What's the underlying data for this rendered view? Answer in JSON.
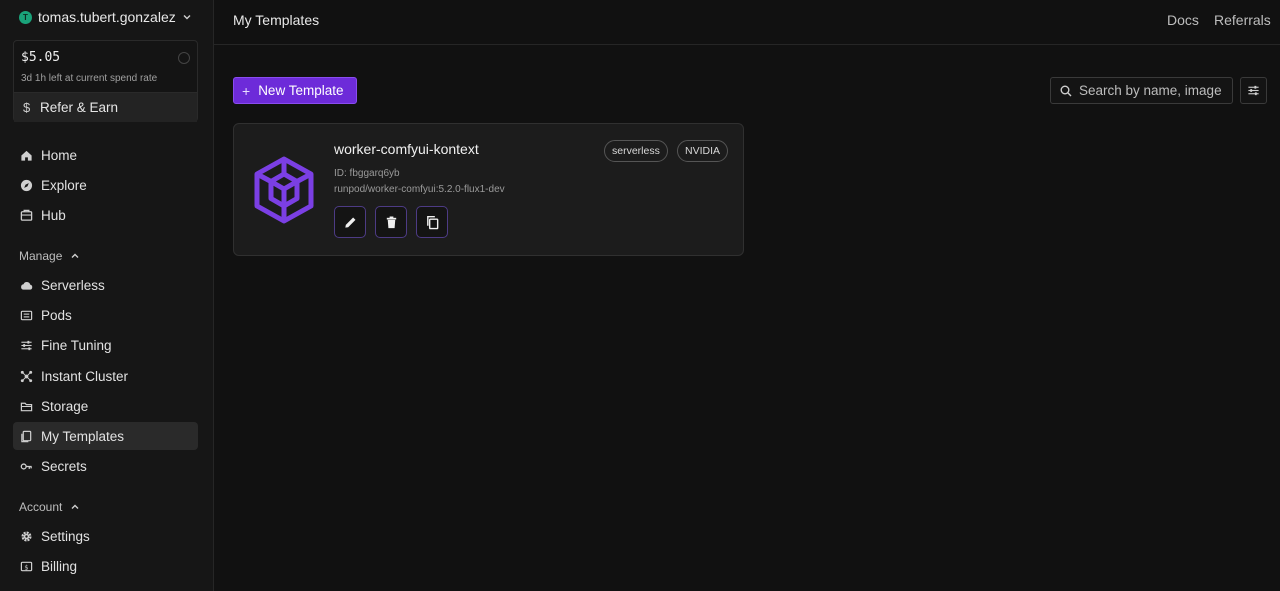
{
  "sidebar": {
    "account": {
      "initial": "T",
      "username": "tomas.tubert.gonzalez"
    },
    "balance": {
      "amount": "$5.05",
      "subtext": "3d 1h left at current spend rate",
      "refer_label": "Refer & Earn"
    },
    "nav_main": [
      {
        "label": "Home",
        "icon": "home-icon"
      },
      {
        "label": "Explore",
        "icon": "compass-icon"
      },
      {
        "label": "Hub",
        "icon": "hub-icon"
      }
    ],
    "manage": {
      "label": "Manage",
      "items": [
        {
          "label": "Serverless",
          "icon": "cloud-icon"
        },
        {
          "label": "Pods",
          "icon": "pods-icon"
        },
        {
          "label": "Fine Tuning",
          "icon": "sliders-icon"
        },
        {
          "label": "Instant Cluster",
          "icon": "cluster-icon"
        },
        {
          "label": "Storage",
          "icon": "storage-icon"
        },
        {
          "label": "My Templates",
          "icon": "templates-icon",
          "active": true
        },
        {
          "label": "Secrets",
          "icon": "key-icon"
        }
      ]
    },
    "account_section": {
      "label": "Account",
      "items": [
        {
          "label": "Settings",
          "icon": "gear-icon"
        },
        {
          "label": "Billing",
          "icon": "billing-icon"
        }
      ]
    }
  },
  "topbar": {
    "title": "My Templates",
    "links": [
      "Docs",
      "Referrals"
    ]
  },
  "toolbar": {
    "new_template_label": "New Template",
    "search_placeholder": "Search by name, image"
  },
  "templates": [
    {
      "name": "worker-comfyui-kontext",
      "id_text": "ID: fbggarq6yb",
      "image": "runpod/worker-comfyui:5.2.0-flux1-dev",
      "badges": [
        "serverless",
        "NVIDIA"
      ]
    }
  ],
  "colors": {
    "accent": "#6d2bd9",
    "logo": "#7b3fe4",
    "background": "#111111",
    "card": "#1c1c1c"
  }
}
